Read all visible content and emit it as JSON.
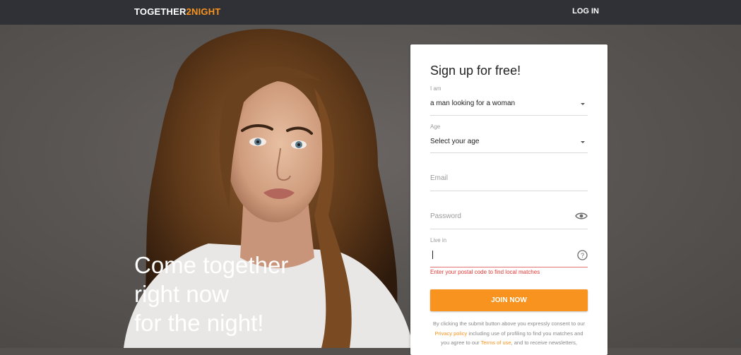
{
  "header": {
    "logo_part1": "TOGETHER",
    "logo_part2": "2NIGHT",
    "login_label": "LOG IN"
  },
  "hero": {
    "tagline_line1": "Come together",
    "tagline_line2": "right now",
    "tagline_line3": "for the night!"
  },
  "form": {
    "title": "Sign up for free!",
    "iam_label": "I am",
    "iam_value": "a man looking for a woman",
    "age_label": "Age",
    "age_value": "Select your age",
    "email_placeholder": "Email",
    "password_placeholder": "Password",
    "livein_label": "Live in",
    "livein_value": "",
    "livein_error": "Enter your postal code to find local matches",
    "join_label": "JOIN NOW",
    "consent_part1": "By clicking the submit button above you expressly consent to our ",
    "privacy_link": "Privacy policy",
    "consent_part2": " including use of profiling to find you matches and you agree to our ",
    "terms_link": "Terms of use",
    "consent_part3": ", and to receive newsletters,"
  },
  "colors": {
    "accent": "#f7931e",
    "topbar": "#2f3136",
    "error": "#e53935"
  },
  "icons": [
    "caret-down-icon",
    "eye-icon",
    "help-icon"
  ]
}
